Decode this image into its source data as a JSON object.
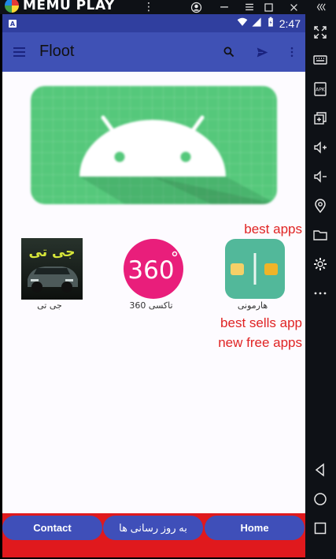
{
  "emulator": {
    "brand": "MEMU PLAY",
    "top_buttons": [
      "more-icon",
      "account-icon",
      "minimize-icon",
      "maximize-icon",
      "close-icon",
      "collapse-sidebar-icon"
    ],
    "sidebar_icons": [
      "fullscreen-icon",
      "keyboard-icon",
      "install-apk-icon",
      "multi-window-icon",
      "volume-up-icon",
      "volume-down-icon",
      "location-icon",
      "folder-icon",
      "settings-icon",
      "more-icon",
      "back-icon",
      "home-icon",
      "recents-icon"
    ]
  },
  "status_bar": {
    "notification_letter": "A",
    "time": "2:47"
  },
  "app_bar": {
    "title": "Floot",
    "actions": [
      "search-icon",
      "send-icon",
      "overflow-menu-icon"
    ]
  },
  "labels": {
    "best_apps": "best apps",
    "best_sells_app": "best sells app",
    "new_free_apps": "new free apps"
  },
  "apps": [
    {
      "name": "هارمونی",
      "icon": "harmony-app-icon"
    },
    {
      "name": "تاکسی 360",
      "icon": "taxi-360-app-icon",
      "icon_text": "360"
    },
    {
      "name": "جی تی",
      "icon": "gta-app-icon",
      "icon_text": "جی تی"
    }
  ],
  "bottom_nav": {
    "contact": "Contact",
    "updates": "به روز رسانی ها",
    "home": "Home"
  },
  "colors": {
    "status_bar": "#303f9f",
    "app_bar": "#3f51b5",
    "accent_red": "#e0191d",
    "bottom_button": "#3f4fb9",
    "banner_green": "#55c87b"
  }
}
